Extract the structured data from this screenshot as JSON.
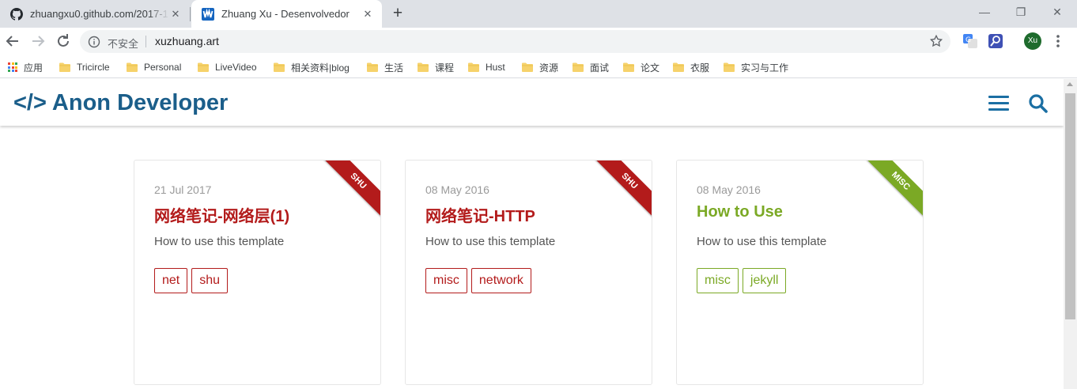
{
  "browser": {
    "tabs": [
      {
        "title": "zhuangxu0.github.com/2017-1",
        "favicon": "github-icon"
      },
      {
        "title": "Zhuang Xu - Desenvolvedor",
        "favicon": "w-logo-icon"
      }
    ],
    "address": {
      "security_label": "不安全",
      "url": "xuzhuang.art"
    },
    "profile_initials": "Xu",
    "bookmarks": [
      {
        "label": "应用",
        "icon": "apps-icon"
      },
      {
        "label": "Tricircle",
        "icon": "folder-icon"
      },
      {
        "label": "Personal",
        "icon": "folder-icon"
      },
      {
        "label": "LiveVideo",
        "icon": "folder-icon"
      },
      {
        "label": "相关资料|blog",
        "icon": "folder-icon"
      },
      {
        "label": "生活",
        "icon": "folder-icon"
      },
      {
        "label": "课程",
        "icon": "folder-icon"
      },
      {
        "label": "Hust",
        "icon": "folder-icon"
      },
      {
        "label": "资源",
        "icon": "folder-icon"
      },
      {
        "label": "面试",
        "icon": "folder-icon"
      },
      {
        "label": "论文",
        "icon": "folder-icon"
      },
      {
        "label": "衣服",
        "icon": "folder-icon"
      },
      {
        "label": "实习与工作",
        "icon": "folder-icon"
      }
    ]
  },
  "site": {
    "logo_symbol": "</>",
    "logo_text": "Anon Developer",
    "accent_color": "#1b5e8a"
  },
  "posts": [
    {
      "date": "21 Jul 2017",
      "title": "网络笔记-网络层(1)",
      "description": "How to use this template",
      "category": "SHU",
      "tags": [
        "net",
        "shu"
      ],
      "color": "#b31b1b"
    },
    {
      "date": "08 May 2016",
      "title": "网络笔记-HTTP",
      "description": "How to use this template",
      "category": "SHU",
      "tags": [
        "misc",
        "network"
      ],
      "color": "#b31b1b"
    },
    {
      "date": "08 May 2016",
      "title": "How to Use",
      "description": "How to use this template",
      "category": "MISC",
      "tags": [
        "misc",
        "jekyll"
      ],
      "color": "#7ba925"
    }
  ]
}
